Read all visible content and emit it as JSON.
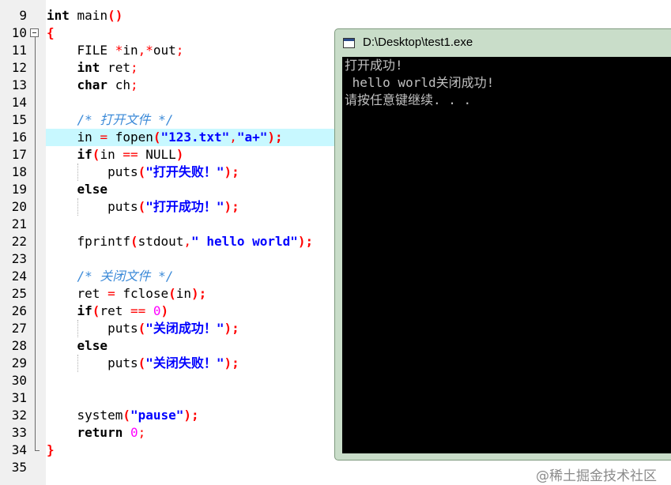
{
  "editor": {
    "lines": [
      {
        "num": "9",
        "tokens": [
          {
            "t": "int",
            "c": "kw"
          },
          {
            "t": " main"
          },
          {
            "t": "()",
            "c": "br"
          }
        ]
      },
      {
        "num": "10",
        "tokens": [
          {
            "t": "{",
            "c": "br"
          }
        ]
      },
      {
        "num": "11",
        "tokens": [
          {
            "t": "    FILE "
          },
          {
            "t": "*",
            "c": "op"
          },
          {
            "t": "in"
          },
          {
            "t": ",",
            "c": "op"
          },
          {
            "t": "*",
            "c": "op"
          },
          {
            "t": "out"
          },
          {
            "t": ";",
            "c": "op"
          }
        ]
      },
      {
        "num": "12",
        "tokens": [
          {
            "t": "    "
          },
          {
            "t": "int",
            "c": "kw"
          },
          {
            "t": " ret"
          },
          {
            "t": ";",
            "c": "op"
          }
        ]
      },
      {
        "num": "13",
        "tokens": [
          {
            "t": "    "
          },
          {
            "t": "char",
            "c": "kw"
          },
          {
            "t": " ch"
          },
          {
            "t": ";",
            "c": "op"
          }
        ]
      },
      {
        "num": "14",
        "tokens": []
      },
      {
        "num": "15",
        "tokens": [
          {
            "t": "    /* 打开文件 */",
            "c": "cm"
          }
        ]
      },
      {
        "num": "16",
        "tokens": [
          {
            "t": "    in "
          },
          {
            "t": "=",
            "c": "op"
          },
          {
            "t": " fopen"
          },
          {
            "t": "(",
            "c": "br"
          },
          {
            "t": "\"123.txt\"",
            "c": "str"
          },
          {
            "t": ",",
            "c": "op"
          },
          {
            "t": "\"a+\"",
            "c": "str"
          },
          {
            "t": ");",
            "c": "br"
          }
        ]
      },
      {
        "num": "17",
        "tokens": [
          {
            "t": "    "
          },
          {
            "t": "if",
            "c": "kw"
          },
          {
            "t": "(",
            "c": "br"
          },
          {
            "t": "in "
          },
          {
            "t": "==",
            "c": "op"
          },
          {
            "t": " NULL"
          },
          {
            "t": ")",
            "c": "br"
          }
        ]
      },
      {
        "num": "18",
        "tokens": [
          {
            "t": "        puts"
          },
          {
            "t": "(",
            "c": "br"
          },
          {
            "t": "\"打开失败！\"",
            "c": "str"
          },
          {
            "t": ");",
            "c": "br"
          }
        ]
      },
      {
        "num": "19",
        "tokens": [
          {
            "t": "    "
          },
          {
            "t": "else",
            "c": "kw"
          }
        ]
      },
      {
        "num": "20",
        "tokens": [
          {
            "t": "        puts"
          },
          {
            "t": "(",
            "c": "br"
          },
          {
            "t": "\"打开成功！\"",
            "c": "str"
          },
          {
            "t": ");",
            "c": "br"
          }
        ]
      },
      {
        "num": "21",
        "tokens": []
      },
      {
        "num": "22",
        "tokens": [
          {
            "t": "    fprintf"
          },
          {
            "t": "(",
            "c": "br"
          },
          {
            "t": "stdout"
          },
          {
            "t": ",",
            "c": "op"
          },
          {
            "t": "\" hello world\"",
            "c": "str"
          },
          {
            "t": ");",
            "c": "br"
          }
        ]
      },
      {
        "num": "23",
        "tokens": []
      },
      {
        "num": "24",
        "tokens": [
          {
            "t": "    /* 关闭文件 */",
            "c": "cm"
          }
        ]
      },
      {
        "num": "25",
        "tokens": [
          {
            "t": "    ret "
          },
          {
            "t": "=",
            "c": "op"
          },
          {
            "t": " fclose"
          },
          {
            "t": "(",
            "c": "br"
          },
          {
            "t": "in"
          },
          {
            "t": ");",
            "c": "br"
          }
        ]
      },
      {
        "num": "26",
        "tokens": [
          {
            "t": "    "
          },
          {
            "t": "if",
            "c": "kw"
          },
          {
            "t": "(",
            "c": "br"
          },
          {
            "t": "ret "
          },
          {
            "t": "==",
            "c": "op"
          },
          {
            "t": " "
          },
          {
            "t": "0",
            "c": "num"
          },
          {
            "t": ")",
            "c": "br"
          }
        ]
      },
      {
        "num": "27",
        "tokens": [
          {
            "t": "        puts"
          },
          {
            "t": "(",
            "c": "br"
          },
          {
            "t": "\"关闭成功！\"",
            "c": "str"
          },
          {
            "t": ");",
            "c": "br"
          }
        ]
      },
      {
        "num": "28",
        "tokens": [
          {
            "t": "    "
          },
          {
            "t": "else",
            "c": "kw"
          }
        ]
      },
      {
        "num": "29",
        "tokens": [
          {
            "t": "        puts"
          },
          {
            "t": "(",
            "c": "br"
          },
          {
            "t": "\"关闭失败！\"",
            "c": "str"
          },
          {
            "t": ");",
            "c": "br"
          }
        ]
      },
      {
        "num": "30",
        "tokens": []
      },
      {
        "num": "31",
        "tokens": []
      },
      {
        "num": "32",
        "tokens": [
          {
            "t": "    system"
          },
          {
            "t": "(",
            "c": "br"
          },
          {
            "t": "\"pause\"",
            "c": "str"
          },
          {
            "t": ");",
            "c": "br"
          }
        ]
      },
      {
        "num": "33",
        "tokens": [
          {
            "t": "    "
          },
          {
            "t": "return",
            "c": "kw"
          },
          {
            "t": " "
          },
          {
            "t": "0",
            "c": "num"
          },
          {
            "t": ";",
            "c": "op"
          }
        ]
      },
      {
        "num": "34",
        "tokens": [
          {
            "t": "}",
            "c": "br"
          }
        ]
      },
      {
        "num": "35",
        "tokens": []
      }
    ]
  },
  "console": {
    "title": "D:\\Desktop\\test1.exe",
    "lines": [
      "打开成功!",
      " hello world关闭成功!",
      "请按任意键继续. . ."
    ]
  },
  "watermark": "@稀土掘金技术社区"
}
